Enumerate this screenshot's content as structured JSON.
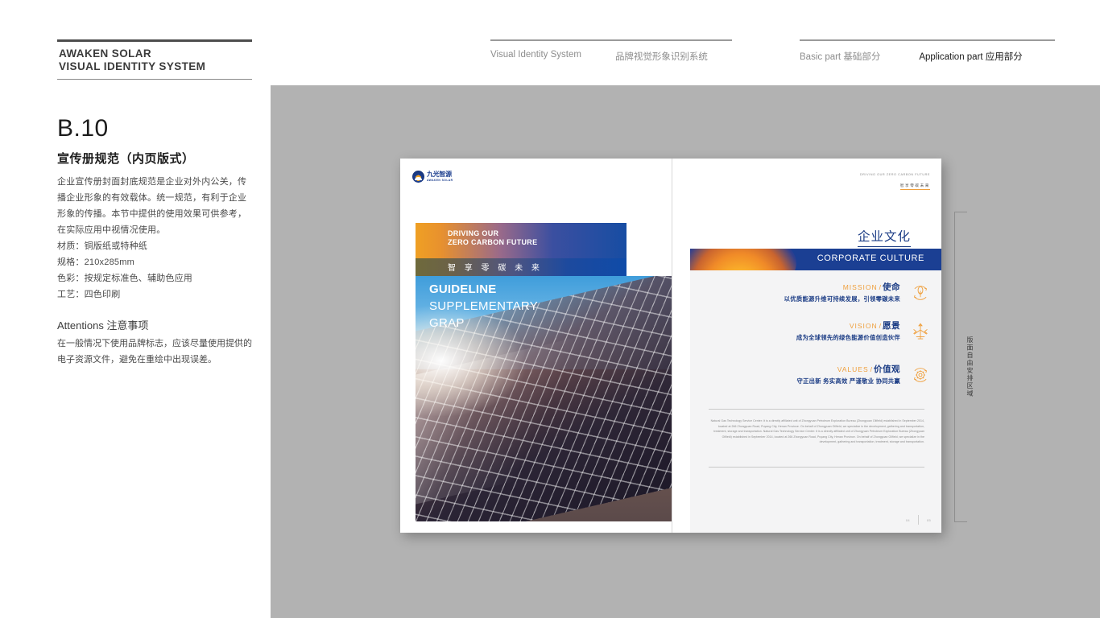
{
  "header": {
    "brand_line1": "AWAKEN SOLAR",
    "brand_line2": "VISUAL IDENTITY SYSTEM",
    "nav_left": [
      {
        "label": "Visual Identity System",
        "active": false
      },
      {
        "label": "品牌视觉形象识别系统",
        "active": false
      }
    ],
    "nav_right": [
      {
        "label": "Basic part  基础部分",
        "active": false
      },
      {
        "label": "Application part  应用部分",
        "active": true
      }
    ]
  },
  "section": {
    "code": "B.10",
    "title": "宣传册规范（内页版式）",
    "description": "企业宣传册封面封底规范是企业对外内公关，传播企业形象的有效载体。统一规范，有利于企业形象的传播。本节中提供的使用效果可供参考，在实际应用中视情况使用。",
    "specs": [
      "材质：铜版纸或特种纸",
      "规格：210x285mm",
      "色彩：按规定标准色、辅助色应用",
      "工艺：四色印刷"
    ],
    "attentions_title": "Attentions 注意事项",
    "attentions_body": "在一般情况下使用品牌标志，应该尽量使用提供的电子资源文件，避免在重绘中出现误差。"
  },
  "cover": {
    "logo_cn": "九光智源",
    "logo_en": "AWAKEN SOLAR",
    "banner_en_line1": "DRIVING OUR",
    "banner_en_line2": "ZERO CARBON FUTURE",
    "banner_cn": "智 享 零 碳 未 来",
    "title_line1": "GUIDELINE",
    "title_line2": "SUPPLEMENTARY",
    "title_line3": "GRAP"
  },
  "inner_page": {
    "head_en": "DRIVING OUR ZERO CARBON FUTURE",
    "head_cn": "智享零碳未来",
    "title_cn": "企业文化",
    "title_en": "CORPORATE CULTURE",
    "blocks": [
      {
        "en": "MISSION",
        "cn": "使命",
        "desc": "以优质能源升维可持续发展，引领零碳未来",
        "icon": "leaf-cycle-icon"
      },
      {
        "en": "VISION",
        "cn": "愿景",
        "desc": "成为全球领先的绿色能源价值创造伙伴",
        "icon": "wind-turbine-icon"
      },
      {
        "en": "VALUES",
        "cn": "价值观",
        "desc": "守正出新  务实高效   严谨敬业  协同共赢",
        "icon": "atom-cycle-icon"
      }
    ],
    "paragraph": "Natural Gas Technology Service Center: It is a directly affiliated unit of Zhongyuan Petroleum Exploration Bureau (Zhongyuan Oilfield) established in September 2014, located at 266 Zhongyuan Road, Puyang City, Henan Province. On behalf of Zhongyuan Oilfield, we specialize in the development, gathering and transportation, treatment, storage and transportation. Natural Gas Technology Service Center: It is a directly affiliated unit of Zhongyuan Petroleum Exploration Bureau (Zhongyuan Oilfield) established in September 2014, located at 266 Zhongyuan Road, Puyang City, Henan Province. On behalf of Zhongyuan Oilfield, we specialize in the development, gathering and transportation, treatment, storage and transportation.",
    "page_number_left": "04",
    "page_number_right": "05"
  },
  "callout": {
    "label": "版面自由安排区域"
  },
  "colors": {
    "brand_blue": "#1b3c85",
    "accent_orange": "#ef9f3c",
    "canvas_gray": "#b2b2b2",
    "banner_blue": "#1b3f93"
  }
}
